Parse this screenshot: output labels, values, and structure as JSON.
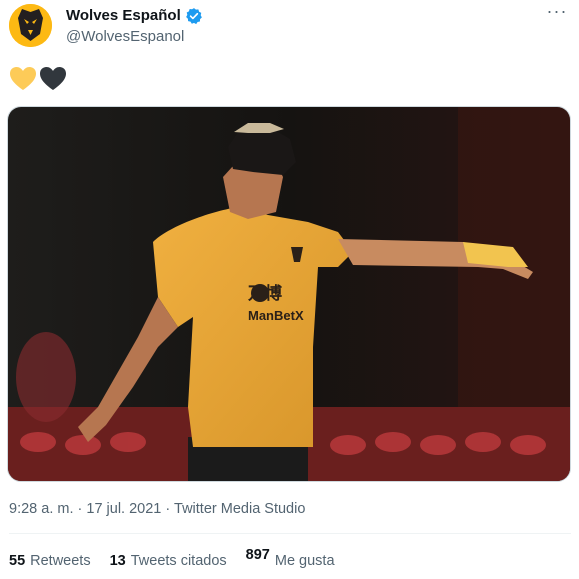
{
  "author": {
    "display_name": "Wolves Español",
    "handle": "@WolvesEspanol",
    "verified": true,
    "avatar_icon": "wolves-crest-icon"
  },
  "tweet": {
    "text_icons": [
      "yellow-heart-icon",
      "black-heart-icon"
    ],
    "media": {
      "shirt_text_sponsor": "ManBetX",
      "shirt_text_chinese": "万博"
    },
    "time": "9:28 a. m.",
    "separator": "·",
    "date": "17 jul. 2021",
    "source": "Twitter Media Studio"
  },
  "stats": {
    "retweets_count": "55",
    "retweets_label": "Retweets",
    "quotes_count": "13",
    "quotes_label": "Tweets citados",
    "likes_count": "897",
    "likes_label": "Me gusta"
  },
  "colors": {
    "brand_gold": "#fdb913",
    "text_primary": "#0f1419",
    "text_secondary": "#536471",
    "verified_blue": "#1d9bf0"
  }
}
